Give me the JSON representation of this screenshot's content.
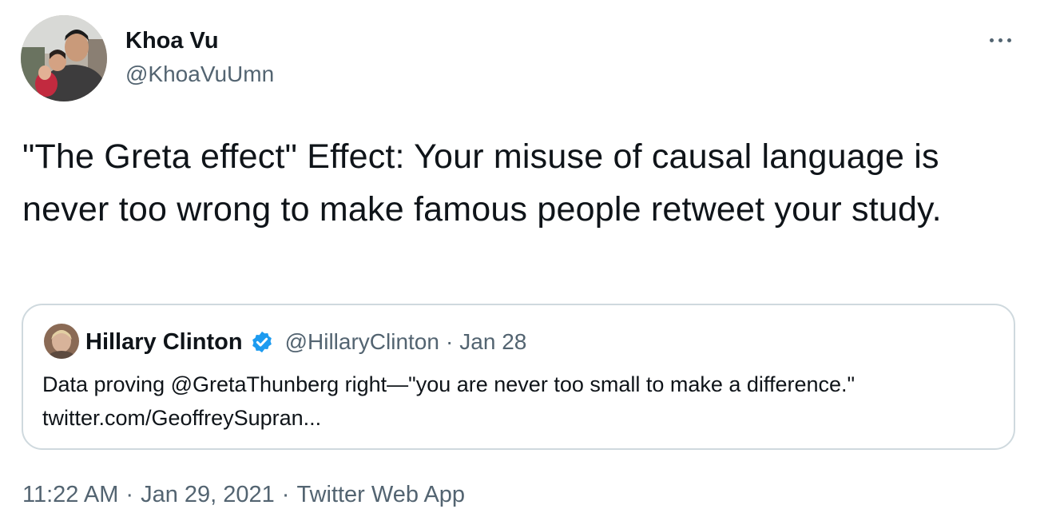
{
  "tweet": {
    "author": {
      "display_name": "Khoa Vu",
      "handle": "@KhoaVuUmn",
      "avatar_icon": "user-avatar-photo"
    },
    "more_icon": "more-options-icon",
    "text": "\"The Greta effect\" Effect: Your misuse of causal language is never too wrong to make famous people retweet your study.",
    "quoted": {
      "display_name": "Hillary Clinton",
      "verified_icon": "verified-badge-icon",
      "handle": "@HillaryClinton",
      "separator": "·",
      "date": "Jan 28",
      "text": "Data proving @GretaThunberg right—\"you are never too small to make a difference.\" twitter.com/GeoffreySupran..."
    },
    "meta": {
      "time": "11:22 AM",
      "date": "Jan 29, 2021",
      "separator": "·",
      "source": "Twitter Web App"
    },
    "colors": {
      "text": "#0f1419",
      "secondary": "#536471",
      "border": "#cfd9de",
      "verified": "#1d9bf0"
    }
  }
}
